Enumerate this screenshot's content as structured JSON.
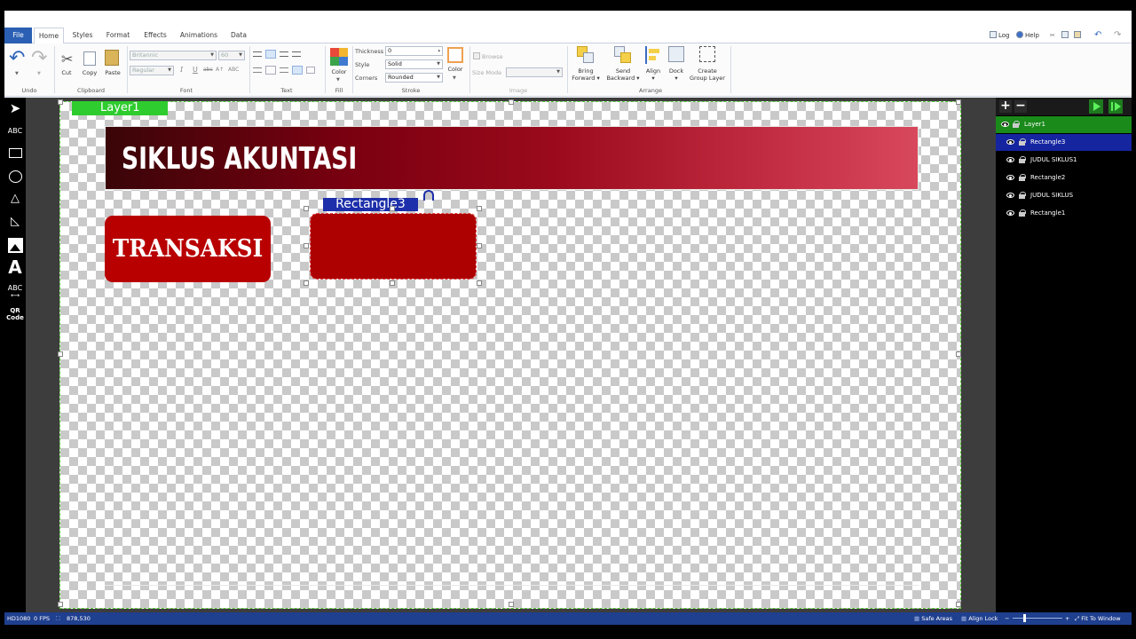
{
  "tabs": [
    {
      "label": "File"
    },
    {
      "label": "Home"
    },
    {
      "label": "Styles"
    },
    {
      "label": "Format"
    },
    {
      "label": "Effects"
    },
    {
      "label": "Animations"
    },
    {
      "label": "Data"
    }
  ],
  "top_right": {
    "log": "Log",
    "help": "Help"
  },
  "ribbon": {
    "undo_group": "Undo",
    "clipboard": {
      "label": "Clipboard",
      "cut": "Cut",
      "copy": "Copy",
      "paste": "Paste"
    },
    "font": {
      "label": "Font",
      "family": "Britannic",
      "size": "60",
      "style": "Regular"
    },
    "text_group": "Text",
    "fill": {
      "label": "Fill",
      "color": "Color"
    },
    "stroke": {
      "label": "Stroke",
      "thickness_label": "Thickness",
      "thickness_value": "0",
      "style_label": "Style",
      "style_value": "Solid",
      "corners_label": "Corners",
      "corners_value": "Rounded",
      "color": "Color"
    },
    "image": {
      "label": "Image",
      "browse": "Browse",
      "size_mode": "Size Mode"
    },
    "arrange": {
      "label": "Arrange",
      "bring_forward_1": "Bring",
      "bring_forward_2": "Forward",
      "send_backward_1": "Send",
      "send_backward_2": "Backward",
      "align": "Align",
      "dock": "Dock",
      "create_group_1": "Create",
      "create_group_2": "Group Layer"
    }
  },
  "left_tools": {
    "text": "ABC",
    "textpath": "ABC",
    "qr_1": "QR",
    "qr_2": "Code"
  },
  "canvas": {
    "layer_tag": "Layer1",
    "banner_text": "SIKLUS AKUNTASI",
    "box_text": "TRANSAKSI",
    "selected_tag": "Rectangle3"
  },
  "layers": [
    {
      "name": "Layer1"
    },
    {
      "name": "Rectangle3"
    },
    {
      "name": "JUDUL SIKLUS1"
    },
    {
      "name": "Rectangle2"
    },
    {
      "name": "JUDUL SIKLUS"
    },
    {
      "name": "Rectangle1"
    }
  ],
  "status": {
    "format": "HD1080",
    "fps": "0 FPS",
    "coords": "878,530",
    "safe_areas": "Safe Areas",
    "align_lock": "Align Lock",
    "fit": "Fit To Window"
  },
  "colors": {
    "accent": "#2b5fb3",
    "selection": "#1d2faa",
    "layer_green": "#2ecc2e",
    "banner_dark": "#3a0508",
    "banner_light": "#d8485c",
    "box_red": "#b80000"
  }
}
